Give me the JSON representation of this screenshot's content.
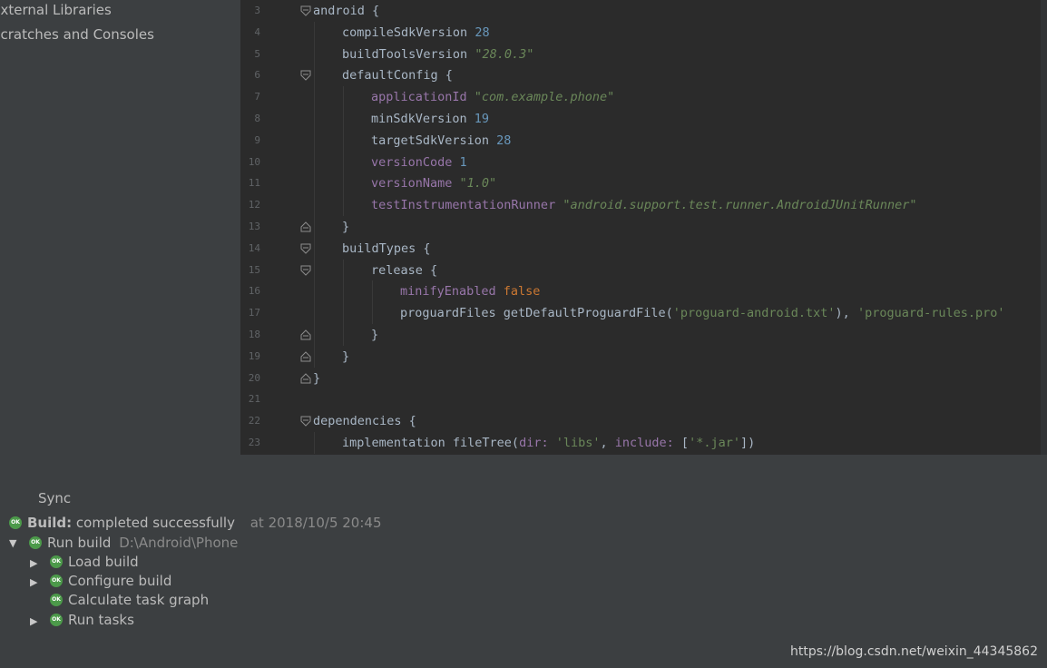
{
  "sidebar": {
    "items": [
      {
        "label": "External Libraries"
      },
      {
        "label": "Scratches and Consoles"
      }
    ]
  },
  "editor": {
    "lines": [
      {
        "n": "3",
        "fold": "open",
        "indent": 0,
        "tokens": [
          [
            "id",
            "android {"
          ]
        ]
      },
      {
        "n": "4",
        "fold": "",
        "indent": 1,
        "tokens": [
          [
            "id",
            "compileSdkVersion "
          ],
          [
            "num",
            "28"
          ]
        ]
      },
      {
        "n": "5",
        "fold": "",
        "indent": 1,
        "tokens": [
          [
            "id",
            "buildToolsVersion "
          ],
          [
            "str",
            "\"28.0.3\""
          ]
        ]
      },
      {
        "n": "6",
        "fold": "open",
        "indent": 1,
        "tokens": [
          [
            "id",
            "defaultConfig {"
          ]
        ]
      },
      {
        "n": "7",
        "fold": "",
        "indent": 2,
        "tokens": [
          [
            "prop",
            "applicationId "
          ],
          [
            "str",
            "\"com.example.phone\""
          ]
        ]
      },
      {
        "n": "8",
        "fold": "",
        "indent": 2,
        "tokens": [
          [
            "id",
            "minSdkVersion "
          ],
          [
            "num",
            "19"
          ]
        ]
      },
      {
        "n": "9",
        "fold": "",
        "indent": 2,
        "tokens": [
          [
            "id",
            "targetSdkVersion "
          ],
          [
            "num",
            "28"
          ]
        ]
      },
      {
        "n": "10",
        "fold": "",
        "indent": 2,
        "tokens": [
          [
            "prop",
            "versionCode "
          ],
          [
            "num",
            "1"
          ]
        ]
      },
      {
        "n": "11",
        "fold": "",
        "indent": 2,
        "tokens": [
          [
            "prop",
            "versionName "
          ],
          [
            "str",
            "\"1.0\""
          ]
        ]
      },
      {
        "n": "12",
        "fold": "",
        "indent": 2,
        "tokens": [
          [
            "prop",
            "testInstrumentationRunner "
          ],
          [
            "str",
            "\"android.support.test.runner.AndroidJUnitRunner\""
          ]
        ]
      },
      {
        "n": "13",
        "fold": "close",
        "indent": 1,
        "tokens": [
          [
            "id",
            "}"
          ]
        ]
      },
      {
        "n": "14",
        "fold": "open",
        "indent": 1,
        "tokens": [
          [
            "id",
            "buildTypes {"
          ]
        ]
      },
      {
        "n": "15",
        "fold": "open",
        "indent": 2,
        "tokens": [
          [
            "id",
            "release {"
          ]
        ]
      },
      {
        "n": "16",
        "fold": "",
        "indent": 3,
        "tokens": [
          [
            "prop",
            "minifyEnabled "
          ],
          [
            "kw",
            "false"
          ]
        ]
      },
      {
        "n": "17",
        "fold": "",
        "indent": 3,
        "tokens": [
          [
            "id",
            "proguardFiles getDefaultProguardFile("
          ],
          [
            "sq",
            "'proguard-android.txt'"
          ],
          [
            "id",
            "), "
          ],
          [
            "sq",
            "'proguard-rules.pro'"
          ]
        ]
      },
      {
        "n": "18",
        "fold": "close",
        "indent": 2,
        "tokens": [
          [
            "id",
            "}"
          ]
        ]
      },
      {
        "n": "19",
        "fold": "close",
        "indent": 1,
        "tokens": [
          [
            "id",
            "}"
          ]
        ]
      },
      {
        "n": "20",
        "fold": "close",
        "indent": 0,
        "tokens": [
          [
            "id",
            "}"
          ]
        ]
      },
      {
        "n": "21",
        "fold": "",
        "indent": 0,
        "tokens": []
      },
      {
        "n": "22",
        "fold": "open",
        "indent": 0,
        "tokens": [
          [
            "id",
            "dependencies {"
          ]
        ]
      },
      {
        "n": "23",
        "fold": "",
        "indent": 1,
        "tokens": [
          [
            "id",
            "implementation fileTree("
          ],
          [
            "prop",
            "dir: "
          ],
          [
            "sq",
            "'libs'"
          ],
          [
            "id",
            ", "
          ],
          [
            "prop",
            "include: "
          ],
          [
            "id",
            "["
          ],
          [
            "sq",
            "'*.jar'"
          ],
          [
            "id",
            "])"
          ]
        ]
      }
    ]
  },
  "build": {
    "tab": "Sync",
    "status_label": "Build:",
    "status_text": "completed successfully",
    "status_time": "at 2018/10/5 20:45",
    "run_label": "Run build",
    "run_path": "D:\\Android\\Phone",
    "children": [
      {
        "label": "Load build",
        "expandable": true
      },
      {
        "label": "Configure build",
        "expandable": true
      },
      {
        "label": "Calculate task graph",
        "expandable": false
      },
      {
        "label": "Run tasks",
        "expandable": true
      }
    ],
    "ok_icon_text": "OK"
  },
  "watermark": "https://blog.csdn.net/weixin_44345862",
  "colors": {
    "editor_bg": "#2b2b2b",
    "panel_bg": "#3c3f41",
    "keyword": "#cc7832",
    "string": "#6a8759",
    "number": "#6897bb",
    "property": "#9876aa",
    "ok_green": "#4c9a4a"
  }
}
